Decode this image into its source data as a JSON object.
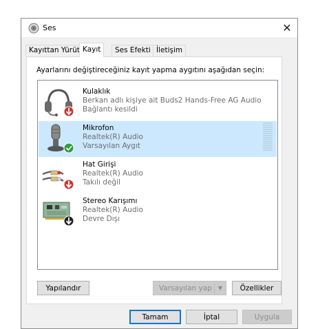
{
  "window": {
    "title": "Ses",
    "close_glyph": "✕"
  },
  "tabs": [
    {
      "label": "Kayıttan Yürüt",
      "active": false
    },
    {
      "label": "Kayıt",
      "active": true
    },
    {
      "label": "Ses Efekti",
      "active": false
    },
    {
      "label": "İletişim",
      "active": false
    }
  ],
  "instruction": "Ayarlarını değiştireceğiniz kayıt yapma aygıtını aşağıdan seçin:",
  "devices": [
    {
      "name": "Kulaklık",
      "line2": "Berkan adlı kişiye ait Buds2 Hands-Free AG Audio",
      "status": "Bağlantı kesildi",
      "icon": "headset-icon",
      "badge": "red-down-arrow"
    },
    {
      "name": "Mikrofon",
      "line2": "Realtek(R) Audio",
      "status": "Varsayılan Aygıt",
      "icon": "microphone-icon",
      "badge": "green-check",
      "selected": true
    },
    {
      "name": "Hat Girişi",
      "line2": "Realtek(R) Audio",
      "status": "Takılı değil",
      "icon": "line-in-cable-icon",
      "badge": "red-down-arrow"
    },
    {
      "name": "Stereo Karışımı",
      "line2": "Realtek(R) Audio",
      "status": "Devre Dışı",
      "icon": "sound-card-icon",
      "badge": "black-down-arrow"
    }
  ],
  "buttons": {
    "configure": "Yapılandır",
    "set_default": "Varsayılan yap",
    "properties": "Özellikler",
    "ok": "Tamam",
    "cancel": "İptal",
    "apply": "Uygula"
  },
  "colors": {
    "selection": "#cce8ff",
    "default_button_border": "#0078d7"
  }
}
